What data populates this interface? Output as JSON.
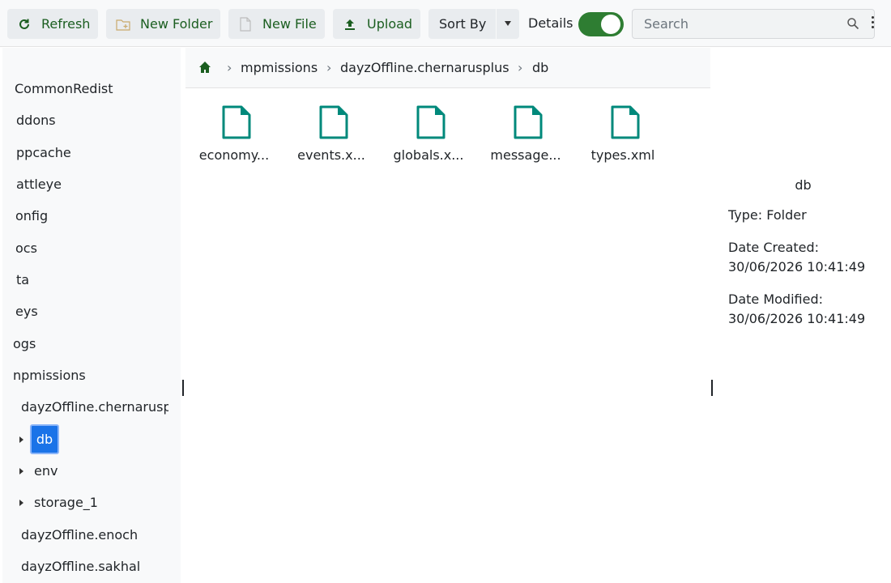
{
  "toolbar": {
    "refresh_label": "Refresh",
    "new_folder_label": "New Folder",
    "new_file_label": "New File",
    "upload_label": "Upload",
    "sort_label": "Sort By",
    "details_label": "Details",
    "details_enabled": true,
    "search_placeholder": "Search",
    "accent_color": "#1b5e20"
  },
  "tree": {
    "items": [
      {
        "label": "CommonRedist"
      },
      {
        "label": "ddons"
      },
      {
        "label": "ppcache"
      },
      {
        "label": "attleye"
      },
      {
        "label": "onfig"
      },
      {
        "label": "ocs"
      },
      {
        "label": "ta"
      },
      {
        "label": "eys"
      },
      {
        "label": "ogs"
      },
      {
        "label": "npmissions"
      },
      {
        "label": "dayzOffline.chernarusplus"
      },
      {
        "label": "db"
      },
      {
        "label": "env"
      },
      {
        "label": "storage_1"
      },
      {
        "label": "dayzOffline.enoch"
      },
      {
        "label": "dayzOffline.sakhal"
      }
    ],
    "selected": "db",
    "selected_color": "#1a73e8"
  },
  "breadcrumb": {
    "items": [
      "mpmissions",
      "dayzOffline.chernarusplus",
      "db"
    ],
    "separator": "›"
  },
  "files": [
    {
      "name": "economy...",
      "icon": "file-icon"
    },
    {
      "name": "events.x...",
      "icon": "file-icon"
    },
    {
      "name": "globals.x...",
      "icon": "file-icon"
    },
    {
      "name": "message...",
      "icon": "file-icon"
    },
    {
      "name": "types.xml",
      "icon": "file-icon"
    }
  ],
  "file_icon_color": "#00897b",
  "details": {
    "title": "db",
    "type_line": "Type: Folder",
    "created_label": "Date Created:",
    "created_value": "30/06/2026 10:41:49",
    "modified_label": "Date Modified:",
    "modified_value": "30/06/2026 10:41:49"
  }
}
